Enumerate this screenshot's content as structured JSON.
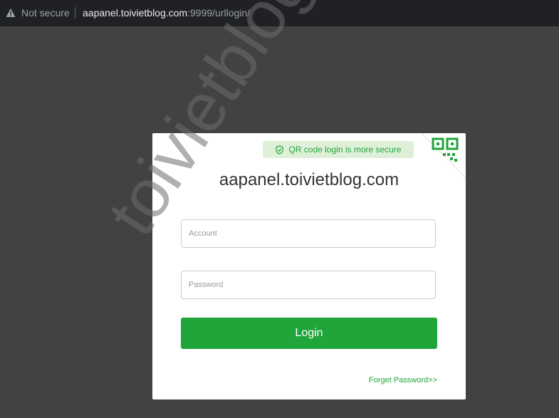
{
  "browser": {
    "security_label": "Not secure",
    "url_host": "aapanel.toivietblog.com",
    "url_rest": ":9999/urllogin/"
  },
  "login": {
    "qr_tip": "QR code login is more secure",
    "site_title": "aapanel.toivietblog.com",
    "account_placeholder": "Account",
    "password_placeholder": "Password",
    "login_label": "Login",
    "forget_label": "Forget Password>>"
  },
  "watermark": {
    "text": "toivietblog.com"
  },
  "colors": {
    "accent": "#20a53a",
    "tip_bg": "#dff0d8",
    "page_bg": "#424242",
    "urlbar_bg": "#202124"
  },
  "icons": {
    "security": "warning-triangle-icon",
    "tip": "shield-check-icon",
    "qr": "qr-code-icon"
  }
}
